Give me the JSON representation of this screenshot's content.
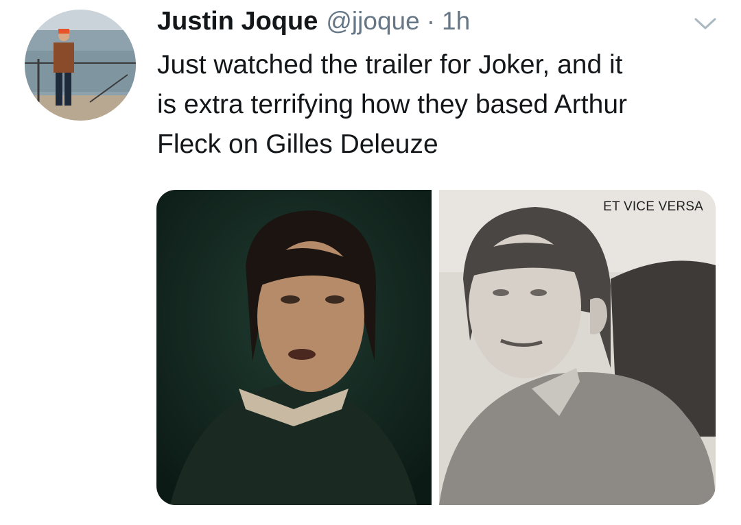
{
  "tweet": {
    "author": {
      "display_name": "Justin Joque",
      "handle": "@jjoque"
    },
    "separator": "·",
    "time": "1h",
    "text_lines": [
      "Just watched the trailer for Joker, and it",
      "is extra terrifying how they based Arthur",
      "Fleck on Gilles Deleuze"
    ],
    "media": {
      "right_image_caption": "ET VICE VERSA"
    }
  },
  "icons": {
    "menu": "chevron-down-icon"
  },
  "colors": {
    "name": "#14171a",
    "secondary": "#657786",
    "chevron": "#aab8c2"
  }
}
